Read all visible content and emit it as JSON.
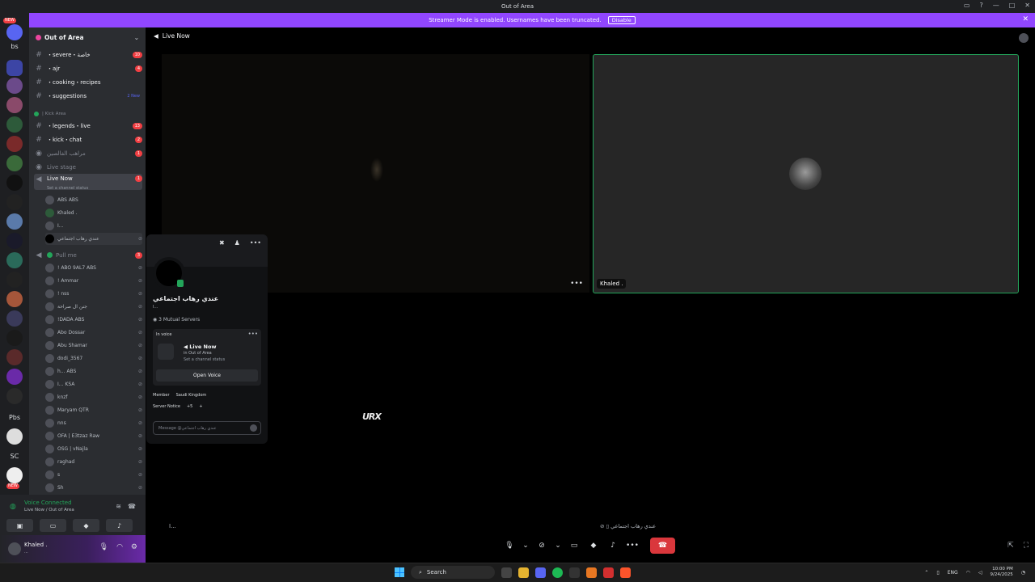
{
  "window": {
    "title": "Out of Area"
  },
  "banner": {
    "text": "Streamer Mode is enabled. Usernames have been truncated.",
    "disable": "Disable"
  },
  "servers": {
    "labels": [
      "bs",
      "Pbs",
      "SC"
    ],
    "badges": [
      "NEW",
      "NEW"
    ]
  },
  "guild": {
    "name": "Out of Area"
  },
  "channels": [
    {
      "icon": "#",
      "label": "・severe・خاصة",
      "count": "10"
    },
    {
      "icon": "#",
      "label": "・ajr",
      "count": "4"
    },
    {
      "icon": "#",
      "label": "・cooking・recipes",
      "count": ""
    },
    {
      "icon": "#",
      "label": "・suggestions",
      "count": "2 New"
    }
  ],
  "category": {
    "label": "| Kick Area"
  },
  "kick_channels": [
    {
      "icon": "#",
      "label": "・legends・live",
      "count": "13"
    },
    {
      "icon": "#",
      "label": "・kick・chat",
      "count": "2"
    },
    {
      "icon": "◉",
      "label": "مراهب الفالصين",
      "count": "1"
    },
    {
      "icon": "◉",
      "label": "Live stage",
      "count": ""
    }
  ],
  "active_channel": {
    "label": "Live Now",
    "count": "1",
    "status": "Set a channel status"
  },
  "live_users": [
    "ABS ABS",
    "Khaled .",
    "I...",
    "عندي رهاب اجتماعي"
  ],
  "pull_channel": {
    "label": "Pull me",
    "count": "3"
  },
  "pull_users": [
    "! ABO 9AL7 ABS",
    "! Ammar",
    "! nss",
    "جنن ال صراحة",
    "!DADA ABS",
    "Abo Dossar",
    "Abu Shamar",
    "dodi_3567",
    "h... ABS",
    "I... KSA",
    "knzf",
    "Maryam QTR",
    "nns",
    "OFA | E3tzaz Raw",
    "OSG | vNajla",
    "raghad",
    "s",
    "Sh"
  ],
  "voice_panel": {
    "title": "Voice Connected",
    "sub": "Live Now / Out of Area"
  },
  "user_panel": {
    "name": "Khaled .",
    "status": "..."
  },
  "call": {
    "title": "Live Now",
    "right_tile_name": "Khaled .",
    "bottom_name": "عندي رهاب اجتماعي",
    "bottom_left": "I...",
    "logo": "URX"
  },
  "popout": {
    "name": "عندي رهاب اجتماعي",
    "user": "I...",
    "mutual": "3 Mutual Servers",
    "in_voice": "In voice",
    "card_title": "Live Now",
    "card_sub": "in Out of Area",
    "card_status": "Set a channel status",
    "open_voice": "Open Voice",
    "role1": "Member",
    "role2": "Saudi Kingdom",
    "role3": "Server Notice",
    "more": "+5",
    "message_placeholder": "Message @عندي رهاب اجتماعي"
  },
  "taskbar": {
    "search": "Search",
    "lang": "ENG",
    "time": "10:00 PM",
    "date": "9/24/2025"
  }
}
